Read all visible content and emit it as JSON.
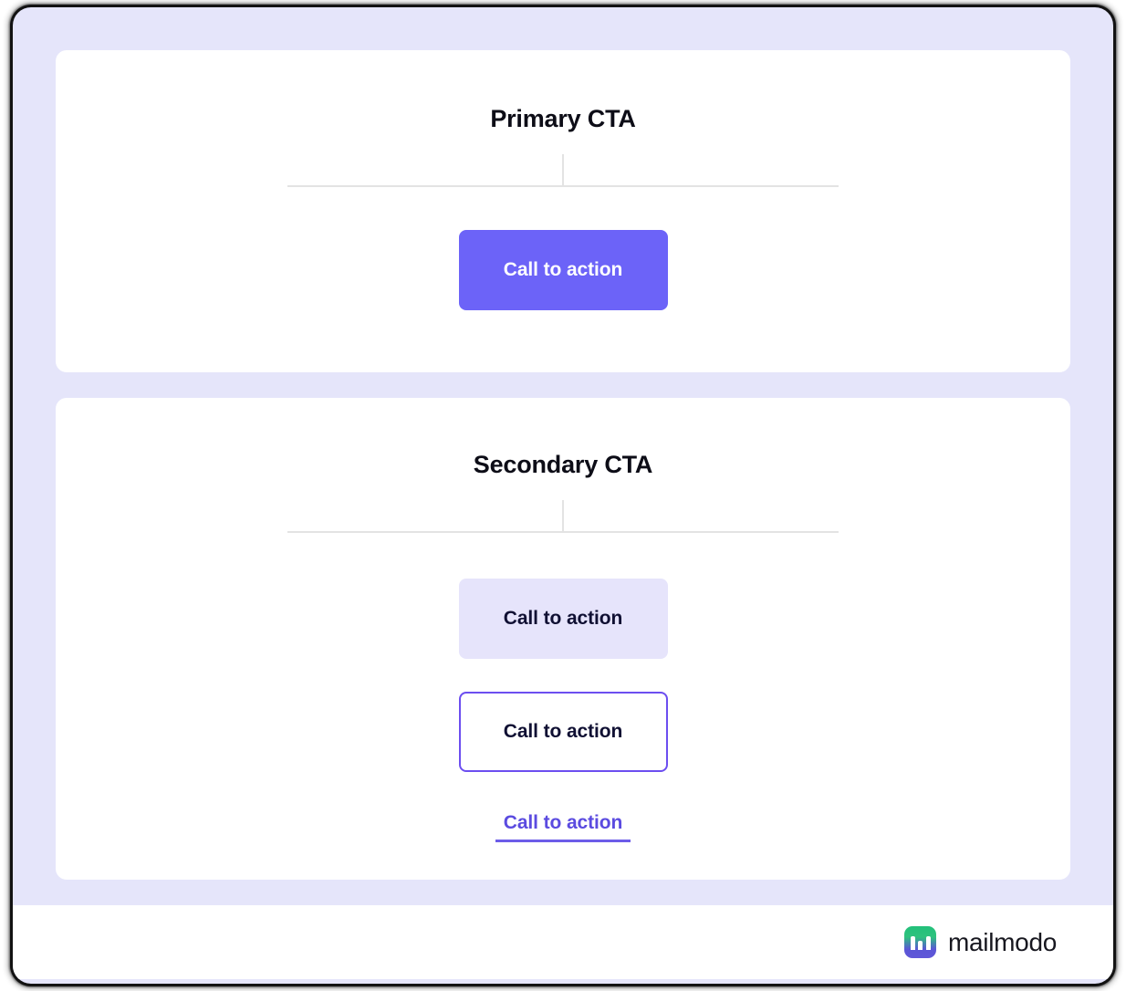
{
  "theme": {
    "frame_background": "#e5e5fa",
    "card_background": "#ffffff",
    "primary_accent": "#6c63f8",
    "soft_accent": "#e6e4fb",
    "outline_accent": "#6c4ef0",
    "link_accent": "#5b4be0",
    "heading_color": "#0d0d17",
    "divider_color": "#e3e3e3"
  },
  "sections": [
    {
      "title": "Primary CTA",
      "buttons": [
        {
          "label": "Call to action",
          "style": "filled"
        }
      ]
    },
    {
      "title": "Secondary CTA",
      "buttons": [
        {
          "label": "Call to action",
          "style": "soft"
        },
        {
          "label": "Call to action",
          "style": "outline"
        },
        {
          "label": "Call to action",
          "style": "link"
        }
      ]
    }
  ],
  "footer": {
    "brand_name": "mailmodo",
    "logo_icon": "mailmodo-logo-icon"
  }
}
